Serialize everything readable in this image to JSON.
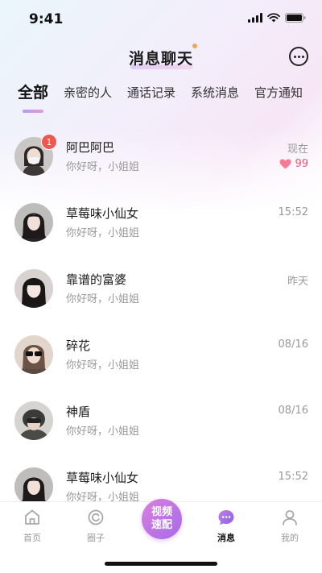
{
  "status_bar": {
    "time": "9:41"
  },
  "header": {
    "title": "消息聊天"
  },
  "tabs": [
    {
      "label": "全部",
      "active": true
    },
    {
      "label": "亲密的人"
    },
    {
      "label": "通话记录"
    },
    {
      "label": "系统消息"
    },
    {
      "label": "官方通知"
    }
  ],
  "conversations": [
    {
      "name": "阿巴阿巴",
      "preview": "你好呀，小姐姐",
      "time": "现在",
      "unread": "1",
      "intimacy": "99",
      "avatar_color": "#6e6a6a"
    },
    {
      "name": "草莓味小仙女",
      "preview": "你好呀，小姐姐",
      "time": "15:52",
      "avatar_color": "#3a3436"
    },
    {
      "name": "靠谱的富婆",
      "preview": "你好呀，小姐姐",
      "time": "昨天",
      "avatar_color": "#2e2a2a"
    },
    {
      "name": "碎花",
      "preview": "你好呀，小姐姐",
      "time": "08/16",
      "avatar_color": "#8a7468"
    },
    {
      "name": "神盾",
      "preview": "你好呀，小姐姐",
      "time": "08/16",
      "avatar_color": "#5a5a5a"
    },
    {
      "name": "草莓味小仙女",
      "preview": "你好呀，小姐姐",
      "time": "15:52",
      "avatar_color": "#3a3436"
    }
  ],
  "tabbar": {
    "home": "首页",
    "circle": "圈子",
    "video_match_line1": "视频",
    "video_match_line2": "速配",
    "messages": "消息",
    "profile": "我的"
  },
  "colors": {
    "accent": "#a66be8",
    "badge": "#f0564f",
    "heart": "#f0566f"
  }
}
